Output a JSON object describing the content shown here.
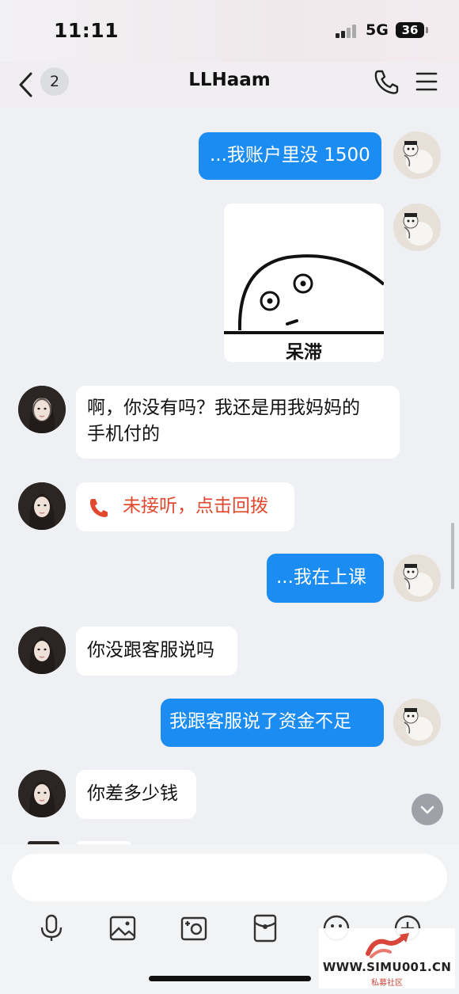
{
  "status_bar": {
    "time": "11:11",
    "network": "5G",
    "battery": "36"
  },
  "header": {
    "unread_count": "2",
    "title": "LLHaam"
  },
  "messages": [
    {
      "side": "out",
      "type": "text",
      "text": "...我账户里没 1500"
    },
    {
      "side": "out",
      "type": "sticker",
      "caption": "呆滞"
    },
    {
      "side": "in",
      "type": "text",
      "lines": [
        "啊，你没有吗？我还是用我妈妈的",
        "手机付的"
      ]
    },
    {
      "side": "in",
      "type": "call",
      "text": "未接听，点击回拨"
    },
    {
      "side": "out",
      "type": "text",
      "text": "...我在上课"
    },
    {
      "side": "in",
      "type": "text",
      "text": "你没跟客服说吗"
    },
    {
      "side": "out",
      "type": "text",
      "text": "我跟客服说了资金不足"
    },
    {
      "side": "in",
      "type": "text",
      "text": "你差多少钱"
    }
  ],
  "input": {
    "placeholder": ""
  },
  "toolbar": [
    "microphone-icon",
    "image-icon",
    "camera-icon",
    "red-packet-icon",
    "emoji-icon",
    "plus-icon"
  ],
  "watermark": {
    "url": "WWW.SIMU001.CN",
    "subtitle": "私募社区"
  },
  "colors": {
    "outgoing_bubble": "#1b8cf2",
    "incoming_bubble": "#ffffff",
    "missed_call": "#e0492f",
    "background": "#eef0f3"
  }
}
